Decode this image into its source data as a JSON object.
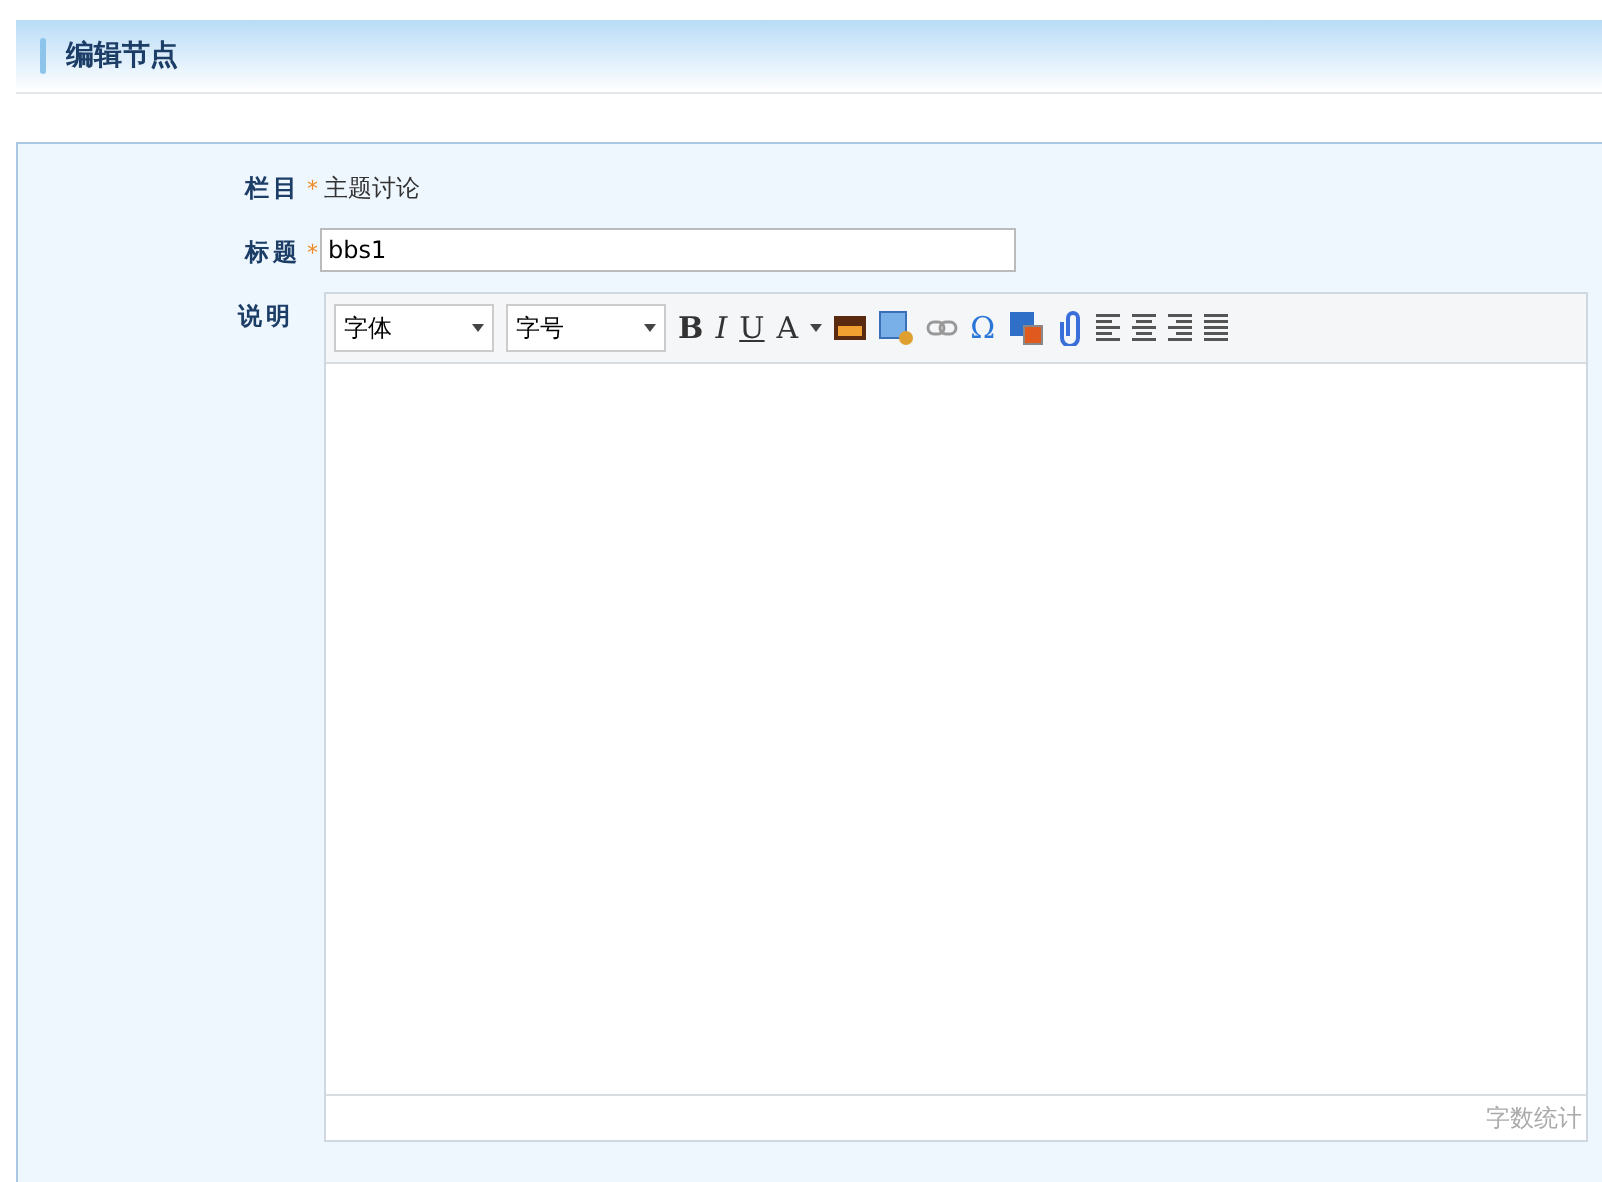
{
  "header": {
    "title": "编辑节点"
  },
  "fields": [
    {
      "kind": "static",
      "label": "栏目",
      "marker": "*",
      "value": "主题讨论"
    },
    {
      "kind": "input",
      "label": "标题",
      "marker": "*",
      "value": "bbs1"
    },
    {
      "kind": "editor",
      "label": "说明"
    }
  ],
  "editor": {
    "selects": [
      {
        "value": "字体"
      },
      {
        "value": "字号"
      }
    ],
    "tools": [
      {
        "kind": "bold",
        "text": "B"
      },
      {
        "kind": "italic",
        "text": "I"
      },
      {
        "kind": "underline",
        "text": "U"
      },
      {
        "kind": "color",
        "text": "A"
      },
      {
        "kind": "image"
      },
      {
        "kind": "imageedit"
      },
      {
        "kind": "link"
      },
      {
        "kind": "symbol",
        "text": "Ω"
      },
      {
        "kind": "document"
      },
      {
        "kind": "attachment"
      },
      {
        "kind": "alignleft"
      },
      {
        "kind": "aligncenter"
      },
      {
        "kind": "alignright"
      },
      {
        "kind": "justify"
      }
    ],
    "word_count": "字数统计"
  }
}
